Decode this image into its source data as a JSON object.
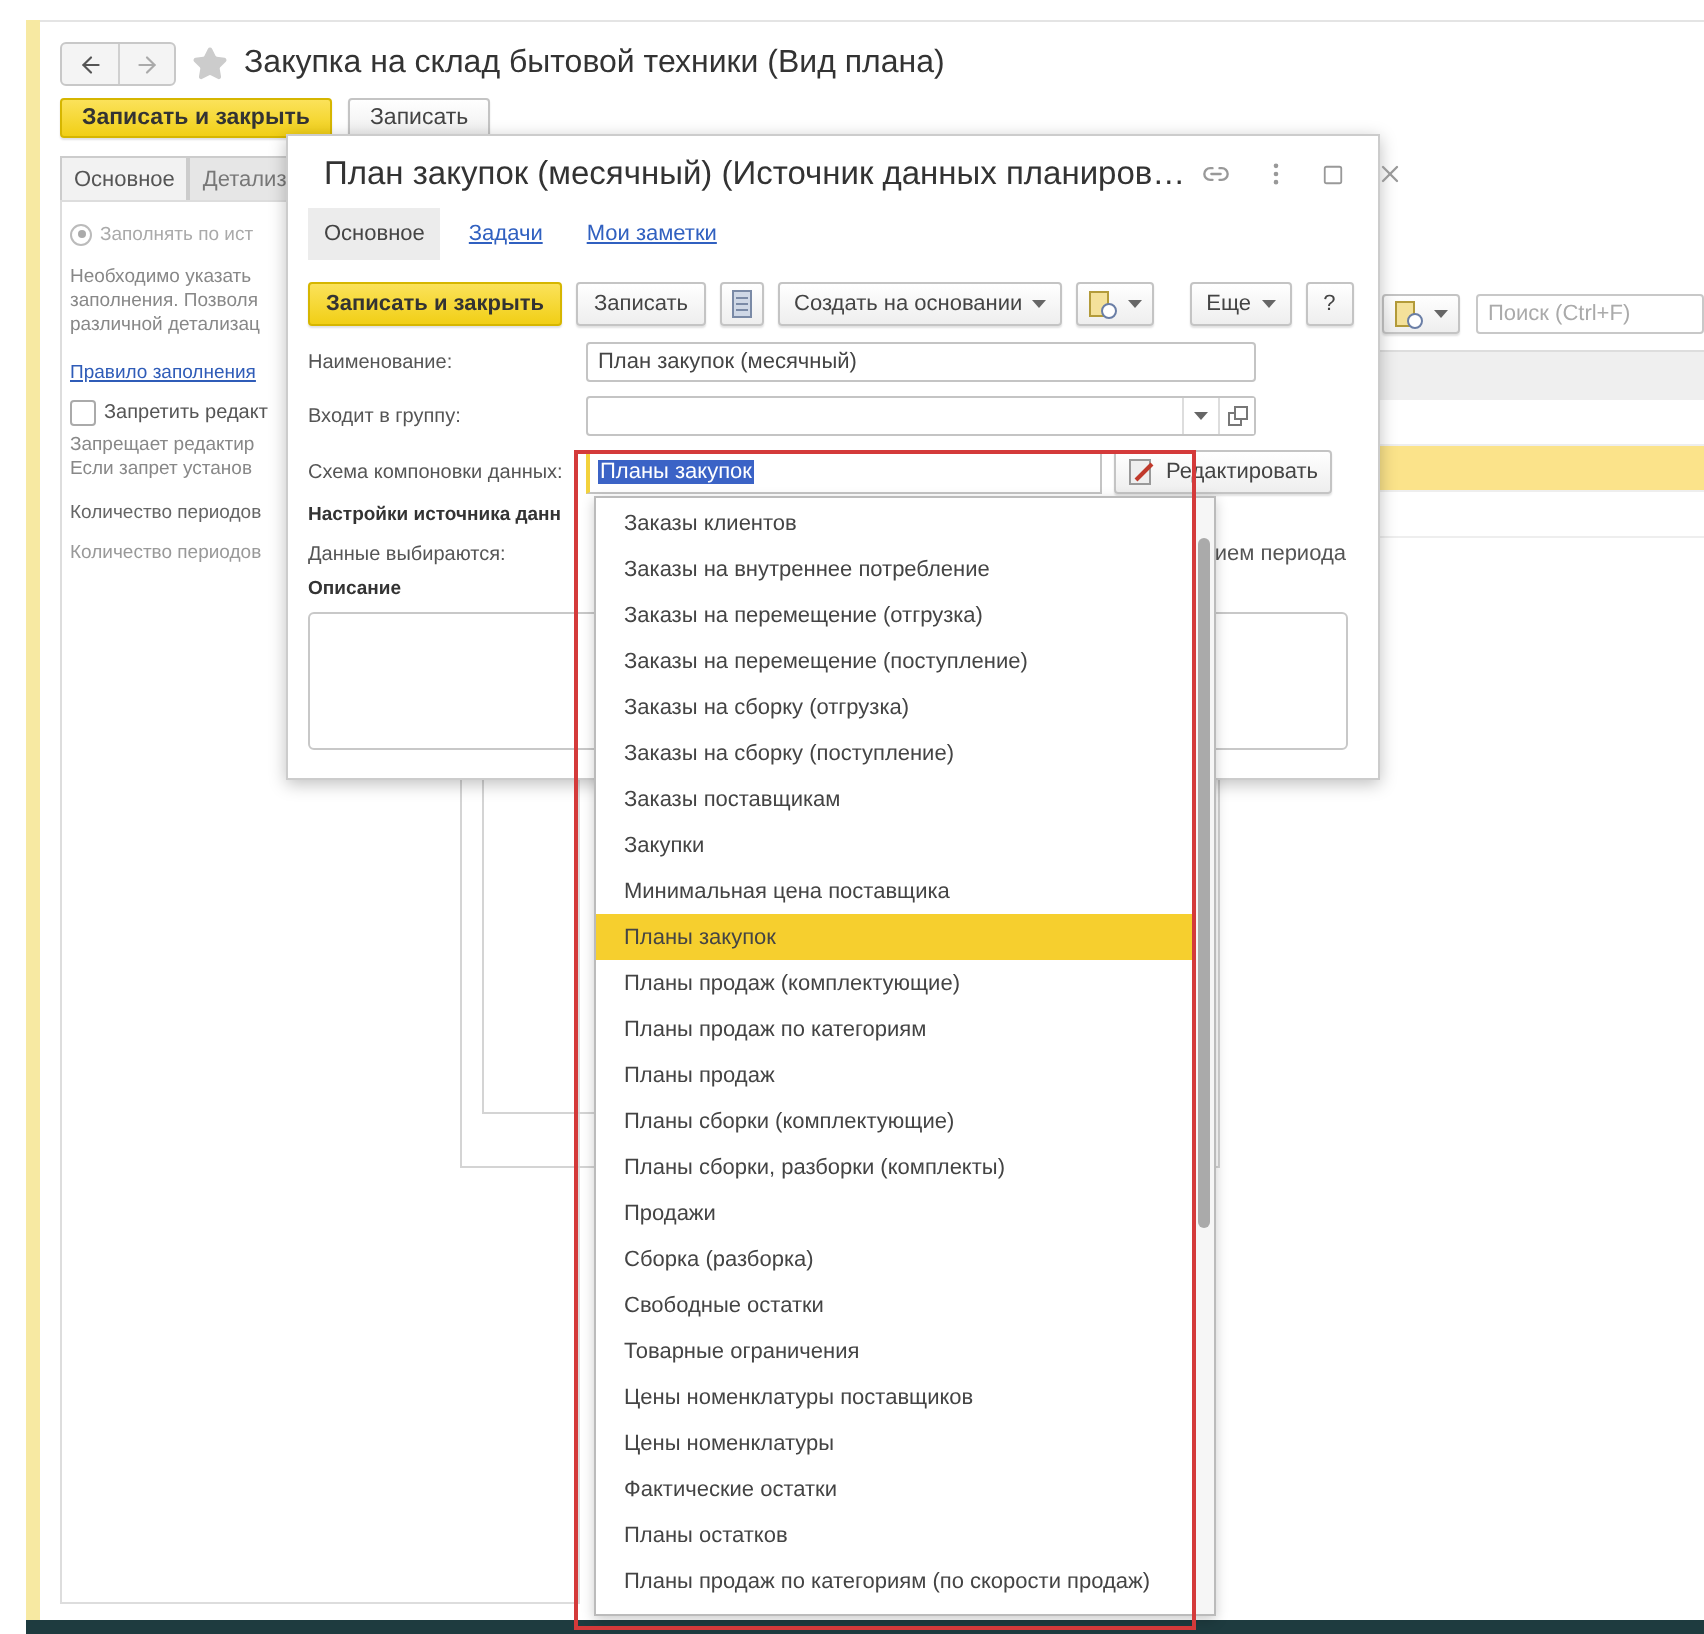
{
  "main_window": {
    "title": "Закупка на склад бытовой техники (Вид плана)",
    "buttons": [
      {
        "label": "Записать и закрыть",
        "kind": "primary"
      },
      {
        "label": "Записать",
        "kind": "default"
      }
    ],
    "tabs": [
      {
        "label": "Основное",
        "selected": true
      },
      {
        "label": "Детализ",
        "selected": false
      }
    ],
    "fill_option": {
      "label": "Заполнять по ист",
      "selected": true,
      "disabled": true
    },
    "note": [
      "Необходимо указать",
      "заполнения. Позволя",
      "различной детализац"
    ],
    "rule_link": "Правило заполнения",
    "lock": {
      "label": "Запретить редакт",
      "checked": false
    },
    "lock_note": [
      "Запрещает редактир",
      "Если запрет установ"
    ],
    "period_fields": [
      {
        "label": "Количество периодов",
        "disabled": false
      },
      {
        "label": "Количество периодов",
        "disabled": true
      }
    ],
    "search": {
      "placeholder": "Поиск (Ctrl+F)"
    }
  },
  "dialog": {
    "title": "План закупок (месячный) (Источник данных планиров…",
    "tabs": [
      {
        "label": "Основное",
        "selected": true
      },
      {
        "label": "Задачи",
        "selected": false
      },
      {
        "label": "Мои заметки",
        "selected": false
      }
    ],
    "toolbar": [
      {
        "kind": "primary",
        "label": "Записать и закрыть"
      },
      {
        "kind": "default",
        "label": "Записать"
      },
      {
        "kind": "icon"
      },
      {
        "kind": "menu",
        "label": "Создать на основании"
      },
      {
        "kind": "icon_menu"
      },
      {
        "kind": "spacer"
      },
      {
        "kind": "menu",
        "label": "Еще"
      },
      {
        "kind": "default",
        "label": "?"
      }
    ],
    "name": {
      "label": "Наименование:",
      "value": "План закупок (месячный)"
    },
    "group": {
      "label": "Входит в группу:"
    },
    "schema": {
      "label": "Схема компоновки данных:",
      "value": "Планы закупок",
      "highlighted": true,
      "edit_button": "Редактировать"
    },
    "settings_heading": "Настройки источника данн",
    "data_selected": {
      "label": "Данные выбираются:",
      "value_tail": "ием периода"
    },
    "description": {
      "label": "Описание"
    }
  },
  "dropdown": {
    "items": [
      {
        "label": "Заказы клиентов",
        "selected": false
      },
      {
        "label": "Заказы на внутреннее потребление",
        "selected": false
      },
      {
        "label": "Заказы на перемещение (отгрузка)",
        "selected": false
      },
      {
        "label": "Заказы на перемещение (поступление)",
        "selected": false
      },
      {
        "label": "Заказы на сборку (отгрузка)",
        "selected": false
      },
      {
        "label": "Заказы на сборку (поступление)",
        "selected": false
      },
      {
        "label": "Заказы поставщикам",
        "selected": false
      },
      {
        "label": "Закупки",
        "selected": false
      },
      {
        "label": "Минимальная цена поставщика",
        "selected": false
      },
      {
        "label": "Планы закупок",
        "selected": true
      },
      {
        "label": "Планы продаж (комплектующие)",
        "selected": false
      },
      {
        "label": "Планы продаж по категориям",
        "selected": false
      },
      {
        "label": "Планы продаж",
        "selected": false
      },
      {
        "label": "Планы сборки (комплектующие)",
        "selected": false
      },
      {
        "label": "Планы сборки, разборки (комплекты)",
        "selected": false
      },
      {
        "label": "Продажи",
        "selected": false
      },
      {
        "label": "Сборка (разборка)",
        "selected": false
      },
      {
        "label": "Свободные остатки",
        "selected": false
      },
      {
        "label": "Товарные ограничения",
        "selected": false
      },
      {
        "label": "Цены номенклатуры поставщиков",
        "selected": false
      },
      {
        "label": "Цены номенклатуры",
        "selected": false
      },
      {
        "label": "Фактические остатки",
        "selected": false
      },
      {
        "label": "Планы остатков",
        "selected": false
      },
      {
        "label": "Планы продаж по категориям (по скорости продаж)",
        "selected": false
      }
    ]
  }
}
